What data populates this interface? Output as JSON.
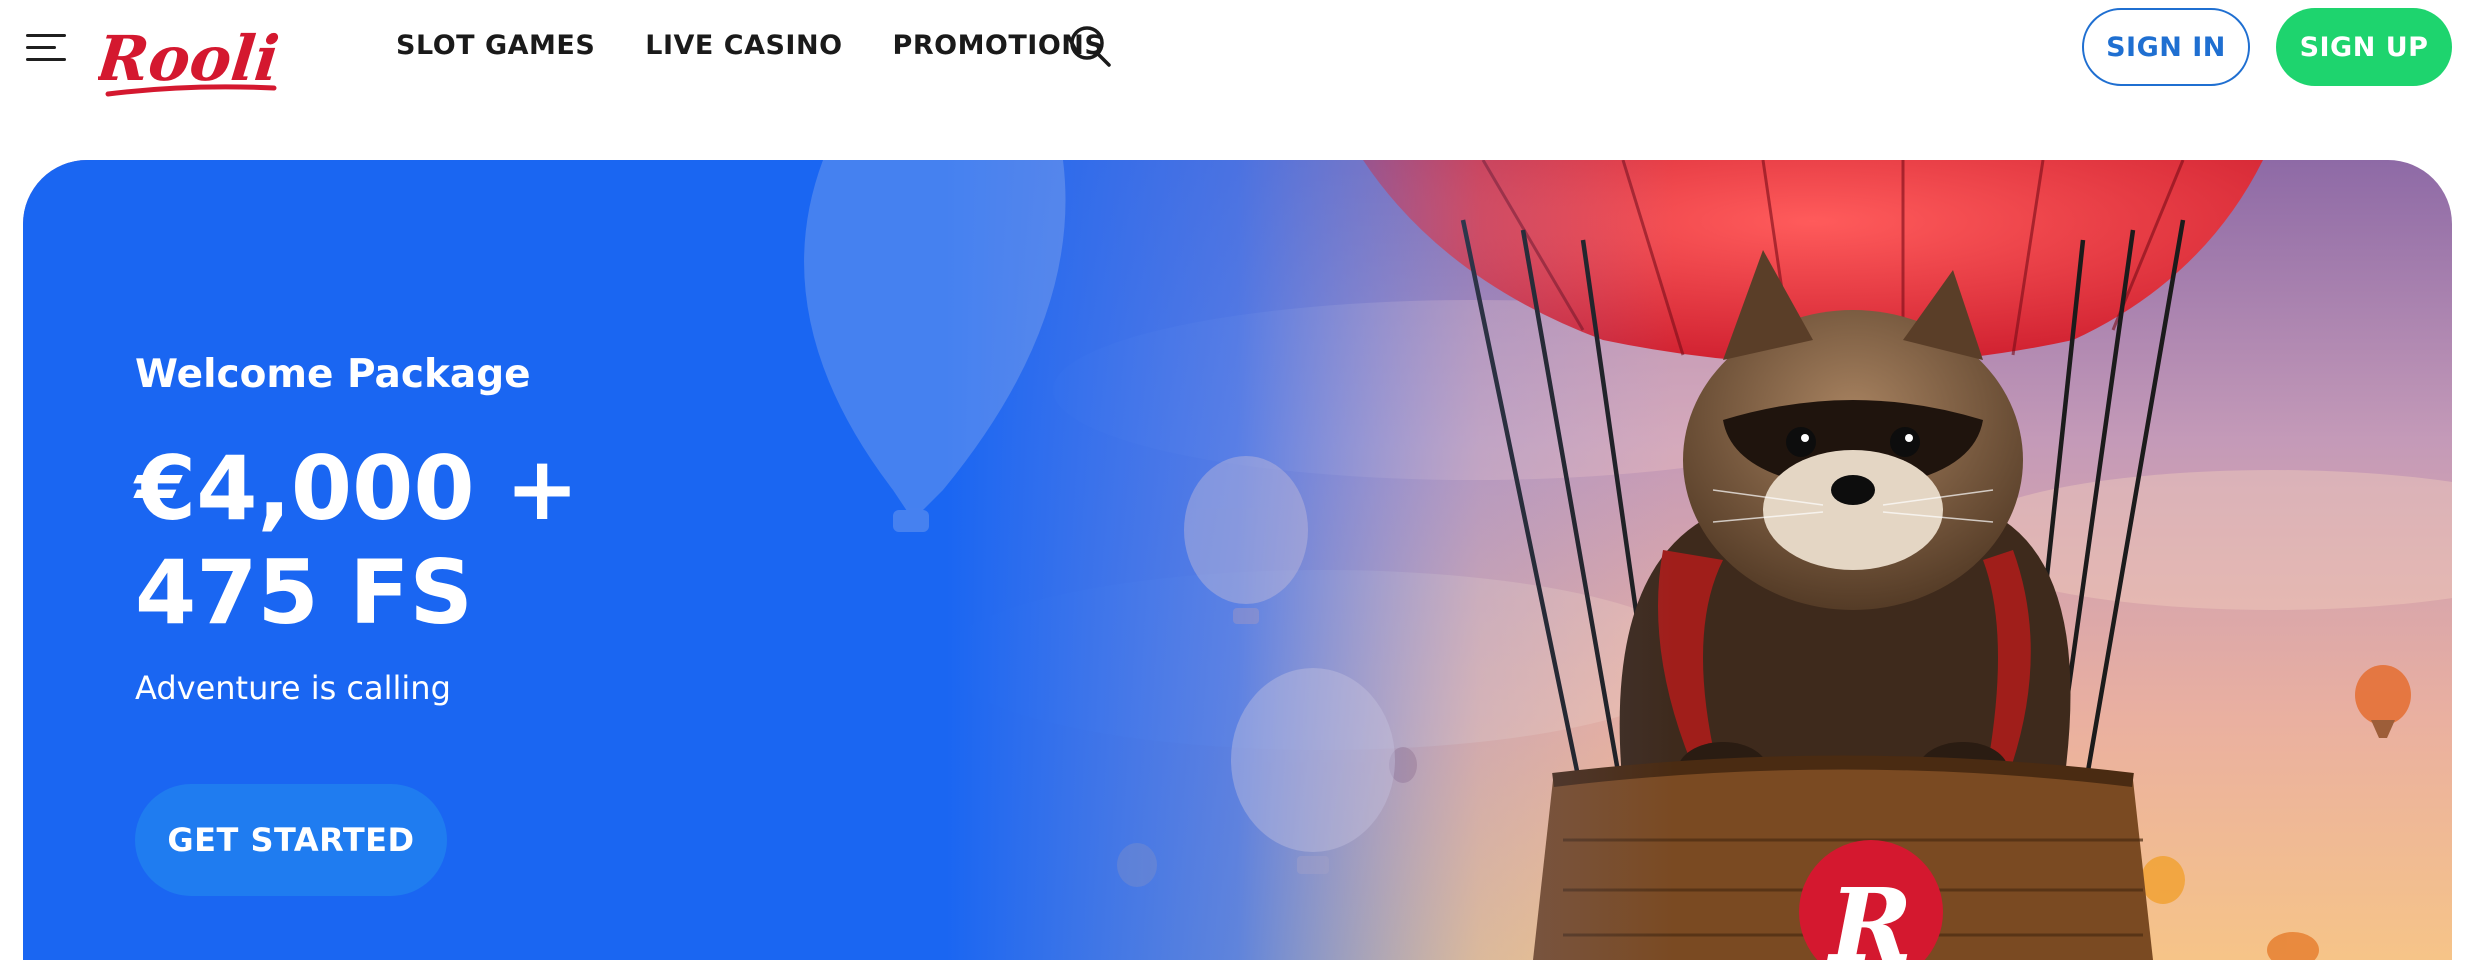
{
  "brand": {
    "logo_text": "Rooli",
    "color": "#d4182f"
  },
  "nav": {
    "items": [
      {
        "label": "SLOT GAMES"
      },
      {
        "label": "LIVE CASINO"
      },
      {
        "label": "PROMOTIONS"
      }
    ]
  },
  "icons": {
    "menu": "hamburger-menu-icon",
    "search": "search-icon",
    "badge": "rooli-r-badge"
  },
  "auth": {
    "signin_label": "SIGN IN",
    "signup_label": "SIGN UP"
  },
  "hero": {
    "subtitle": "Welcome Package",
    "amount_line1": "€4,000 +",
    "amount_line2": "475 FS",
    "tagline": "Adventure is calling",
    "cta_label": "GET STARTED",
    "badge_letter": "R"
  },
  "colors": {
    "primary_blue": "#1f6fd1",
    "signup_green": "#1ed46e",
    "hero_blue": "#1a66f2",
    "brand_red": "#d4182f"
  }
}
